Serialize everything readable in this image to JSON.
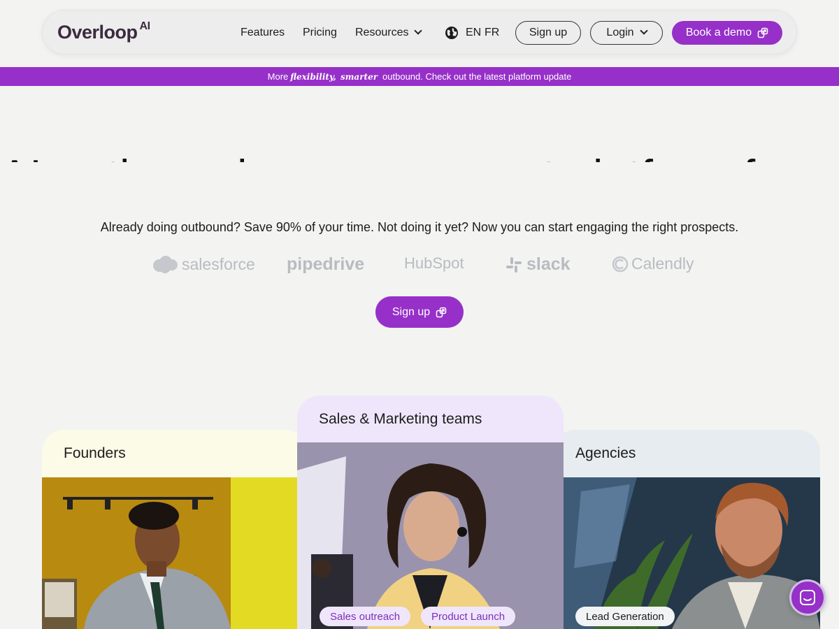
{
  "nav": {
    "logo_text": "Overloop",
    "logo_suffix": "AI",
    "links": [
      "Features",
      "Pricing",
      "Resources"
    ],
    "lang_en": "EN",
    "lang_fr": "FR",
    "signup_label": "Sign up",
    "login_label": "Login",
    "demo_label": "Book a demo"
  },
  "banner": {
    "pre": "More",
    "em1": "flexibility,",
    "em2": "smarter",
    "post": "outbound. Check out the latest platform update"
  },
  "hero": {
    "title": "AI-native sales engagement platform for outbound",
    "subtitle": "Already doing outbound? Save 90% of your time. Not doing it yet? Now you can start engaging the right prospects.",
    "cta_label": "Sign up"
  },
  "integrations": [
    "salesforce",
    "pipedrive",
    "HubSpot",
    "slack",
    "Calendly"
  ],
  "cards": [
    {
      "title": "Founders",
      "tags": []
    },
    {
      "title": "Sales & Marketing teams",
      "tags": [
        "Sales outreach",
        "Product Launch"
      ]
    },
    {
      "title": "Agencies",
      "tags": [
        "Lead Generation"
      ]
    }
  ],
  "colors": {
    "brand": "#9630c8",
    "founders_bg": "#fbfbe8",
    "sales_bg": "#efe6fb",
    "agencies_bg": "#e6ecef",
    "logo_gray": "#b8bcc0"
  },
  "icons": [
    "globe-icon",
    "chevron-down-icon",
    "external-link-icon",
    "chat-icon",
    "salesforce-cloud-icon",
    "slack-hash-icon",
    "calendly-c-icon"
  ]
}
